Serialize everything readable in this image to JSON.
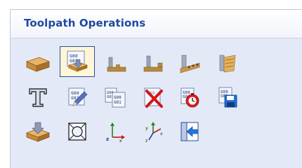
{
  "panel": {
    "title": "Toolpath Operations"
  },
  "toolbar": {
    "buttons": [
      {
        "icon": "material-block-icon",
        "selected": false
      },
      {
        "icon": "gcode-drill-icon",
        "selected": true
      },
      {
        "icon": "profile-toolpath-icon",
        "selected": false
      },
      {
        "icon": "pocket-toolpath-icon",
        "selected": false
      },
      {
        "icon": "drilling-toolpath-icon",
        "selected": false
      },
      {
        "icon": "fluting-toolpath-icon",
        "selected": false
      },
      {
        "icon": "engrave-text-icon",
        "selected": false
      },
      {
        "icon": "edit-gcode-icon",
        "selected": false
      },
      {
        "icon": "merge-gcode-icon",
        "selected": false
      },
      {
        "icon": "delete-gcode-icon",
        "selected": false
      },
      {
        "icon": "time-estimate-icon",
        "selected": false
      },
      {
        "icon": "save-gcode-icon",
        "selected": false
      },
      {
        "icon": "preview-material-icon",
        "selected": false
      },
      {
        "icon": "zoom-extents-icon",
        "selected": false
      },
      {
        "icon": "axis-origin-icon",
        "selected": false
      },
      {
        "icon": "xyz-axes-icon",
        "selected": false
      },
      {
        "icon": "import-icon",
        "selected": false
      }
    ],
    "doc_text_top": "G00",
    "doc_text_bottom": "G01"
  },
  "colors": {
    "panel_bg": "#e3e9f6",
    "title": "#1f4aa0",
    "selection_border": "#2b4f9a",
    "selection_fill": "#fff6d8"
  }
}
